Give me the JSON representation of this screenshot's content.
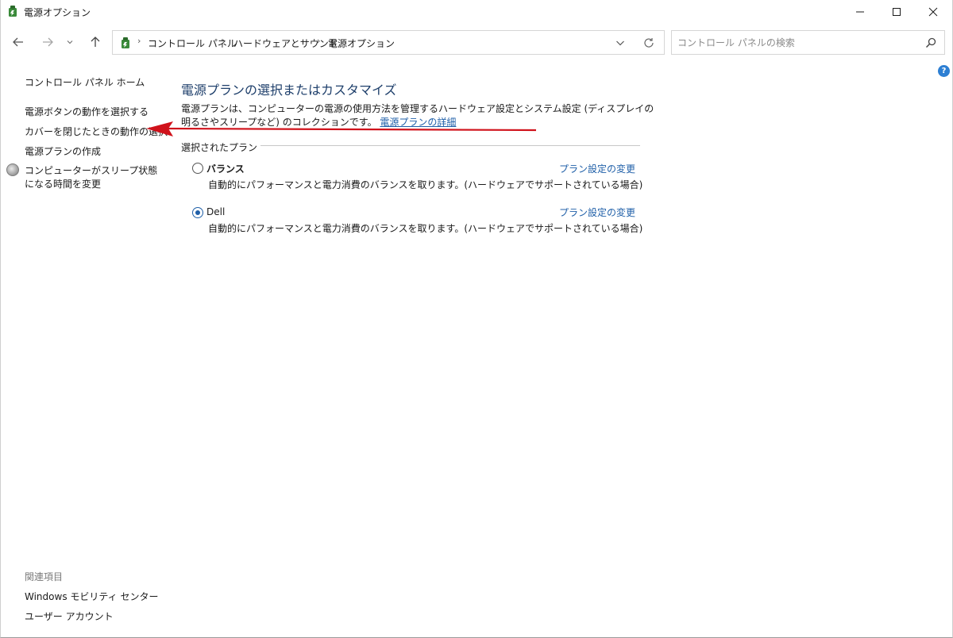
{
  "window": {
    "title": "電源オプション"
  },
  "navigation": {
    "breadcrumbs": [
      "コントロール パネル",
      "ハードウェアとサウンド",
      "電源オプション"
    ],
    "separator": "›",
    "search_placeholder": "コントロール パネルの検索"
  },
  "help": {
    "label": "?"
  },
  "sidebar": {
    "home": "コントロール パネル ホーム",
    "items": [
      "電源ボタンの動作を選択する",
      "カバーを閉じたときの動作の選択",
      "電源プランの作成",
      "コンピューターがスリープ状態になる時間を変更"
    ],
    "related_header": "関連項目",
    "related": [
      "Windows モビリティ センター",
      "ユーザー アカウント"
    ]
  },
  "main": {
    "title": "電源プランの選択またはカスタマイズ",
    "description": "電源プランは、コンピューターの電源の使用方法を管理するハードウェア設定とシステム設定 (ディスプレイの明るさやスリープなど) のコレクションです。",
    "description_link": "電源プランの詳細",
    "group_label": "選択されたプラン",
    "plans": [
      {
        "name": "バランス",
        "description": "自動的にパフォーマンスと電力消費のバランスを取ります。(ハードウェアでサポートされている場合)",
        "link": "プラン設定の変更",
        "selected": false
      },
      {
        "name": "Dell",
        "description": "自動的にパフォーマンスと電力消費のバランスを取ります。(ハードウェアでサポートされている場合)",
        "link": "プラン設定の変更",
        "selected": true
      }
    ]
  },
  "colors": {
    "title": "#1e3f6b",
    "link": "#1f5fa8",
    "annotation_arrow": "#d0121b"
  }
}
